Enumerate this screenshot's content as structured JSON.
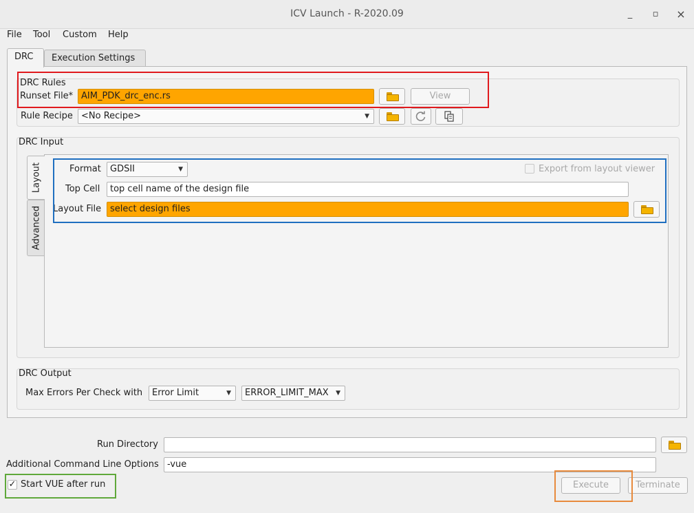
{
  "window": {
    "title": "ICV Launch - R-2020.09",
    "minimize": "_",
    "maximize": "▫",
    "close": "×"
  },
  "menu": [
    "File",
    "Tool",
    "Custom",
    "Help"
  ],
  "tabs": [
    "DRC",
    "Execution Settings"
  ],
  "drc_rules": {
    "title": "DRC Rules",
    "runset_label": "Runset File*",
    "runset_value": "AIM_PDK_drc_enc.rs",
    "view_button": "View",
    "recipe_label": "Rule Recipe",
    "recipe_value": "<No Recipe>"
  },
  "drc_input": {
    "title": "DRC Input",
    "vtabs": [
      "Layout",
      "Advanced"
    ],
    "format_label": "Format",
    "format_value": "GDSII",
    "export_label": "Export from layout viewer",
    "topcell_label": "Top Cell",
    "topcell_value": "top cell name of the design file",
    "layout_label": "Layout File",
    "layout_value": "select design files"
  },
  "drc_output": {
    "title": "DRC Output",
    "max_errors_label": "Max Errors Per Check with",
    "error_limit_value": "Error Limit",
    "error_limit_max_value": "ERROR_LIMIT_MAX"
  },
  "bottom": {
    "run_dir_label": "Run Directory",
    "run_dir_value": "",
    "cmd_label": "Additional Command Line Options",
    "cmd_value": "-vue",
    "vue_check_mark": "✓",
    "vue_label": "Start VUE after run",
    "execute": "Execute",
    "terminate": "Terminate"
  },
  "colors": {
    "required_field": "#ffa500",
    "highlight_red": "#e0191d",
    "highlight_blue": "#1f6fc0",
    "highlight_green": "#5fa83a",
    "highlight_orange": "#e88a3c"
  }
}
